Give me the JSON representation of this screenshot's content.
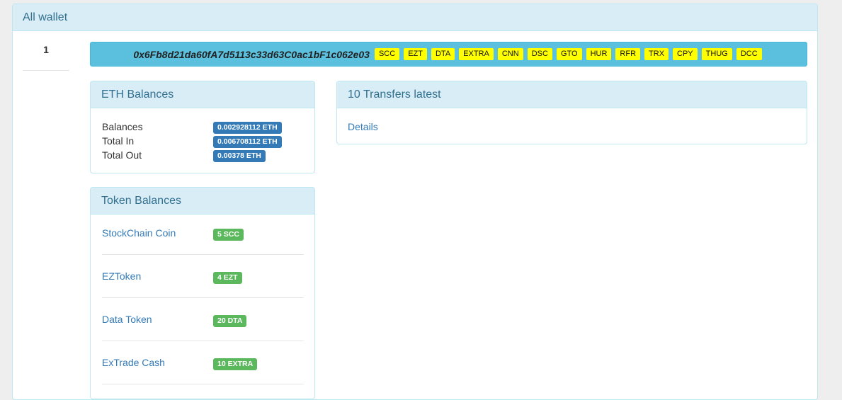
{
  "outer": {
    "title": "All wallet"
  },
  "index": "1",
  "address": {
    "text": "0x6Fb8d21da60fA7d5113c33d63C0ac1bF1c062e03",
    "tags": [
      "SCC",
      "EZT",
      "DTA",
      "EXTRA",
      "CNN",
      "DSC",
      "GTO",
      "HUR",
      "RFR",
      "TRX",
      "CPY",
      "THUG",
      "DCC"
    ]
  },
  "eth": {
    "title": "ETH Balances",
    "rows": [
      {
        "label": "Balances",
        "value": "0.002928112 ETH"
      },
      {
        "label": "Total In",
        "value": "0.006708112 ETH"
      },
      {
        "label": "Total Out",
        "value": "0.00378 ETH"
      }
    ]
  },
  "transfers": {
    "title": "10 Transfers latest",
    "details_label": "Details"
  },
  "tokens": {
    "title": "Token Balances",
    "items": [
      {
        "name": "StockChain Coin",
        "amount": "5 SCC"
      },
      {
        "name": "EZToken",
        "amount": "4 EZT"
      },
      {
        "name": "Data Token",
        "amount": "20 DTA"
      },
      {
        "name": "ExTrade Cash",
        "amount": "10 EXTRA"
      }
    ]
  },
  "colors": {
    "info_bg": "#5bc0de",
    "heading_bg": "#d9edf7",
    "heading_text": "#31708f",
    "tag_yellow": "#ffff00",
    "badge_blue": "#337ab7",
    "badge_green": "#5cb85c"
  }
}
